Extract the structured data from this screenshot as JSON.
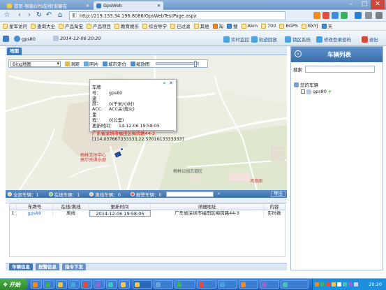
{
  "browser": {
    "tabs": [
      {
        "label": "首页-智能GPS在线|安康在"
      },
      {
        "label": "GpsWeb"
      }
    ],
    "url": "http://219.133.34.196:8086/GpsWebTestPage.aspx"
  },
  "bookmarks": [
    "星军访问",
    "查询大全",
    "产品淘宝",
    "产品项目",
    "教育娱乐",
    "综合导学",
    "已过滤",
    "其他",
    "淘",
    "搜",
    "Akm",
    "700",
    "BGPS",
    "BXYJ",
    "天"
  ],
  "header": {
    "user": "gps80",
    "date": "2014-12-06 20:20",
    "links": [
      "实时监控",
      "轨迹回放",
      "锁区系统",
      "修改登录密码",
      "退出"
    ]
  },
  "map": {
    "tab": "地图",
    "map_type": "Bing地图",
    "tools": [
      "测距",
      "照片",
      "城市定位",
      "缩放图"
    ],
    "labels": [
      "梅林文体中心\n高尔夫俱乐部",
      "梅林公园古道区",
      "鸿浪阁"
    ],
    "popup": {
      "plate_label": "车牌号：",
      "plate": "gps80",
      "speed_label": "速　度：",
      "speed": "0(千米/小时)",
      "acc_label": "ACC:",
      "acc": "ACC关(熄火)",
      "mileage_label": "里　程：",
      "mileage": "0(公里)",
      "updated_label": "更新时间：",
      "updated": "14-12-06 19:58:05",
      "address": "广东省深圳市福田区梅岗路44-3",
      "coords": "[114.037667333333,22.5701613333333]"
    }
  },
  "status": {
    "all": "全部车辆：1",
    "online": "在线车辆：1",
    "offline": "离线车辆：0",
    "alarm": "报警车辆：0",
    "export": "导出"
  },
  "table": {
    "headers": [
      "",
      "车牌号",
      "在线/离线",
      "更新时间",
      "详细地址",
      "内容"
    ],
    "rows": [
      [
        "1",
        "gps80",
        "离线",
        "2014-12-06 19:58:05",
        "广东省深圳市福田区梅岗路44-3",
        "实时数"
      ]
    ]
  },
  "bottom_tabs": [
    "车辆信息",
    "报警信息",
    "指令下发"
  ],
  "vehicle_panel": {
    "title": "车辆列表",
    "search_label": "搜索",
    "group": "您的车辆",
    "vehicle": "gps80"
  },
  "taskbar": {
    "start": "开始",
    "clock": "20:20"
  }
}
